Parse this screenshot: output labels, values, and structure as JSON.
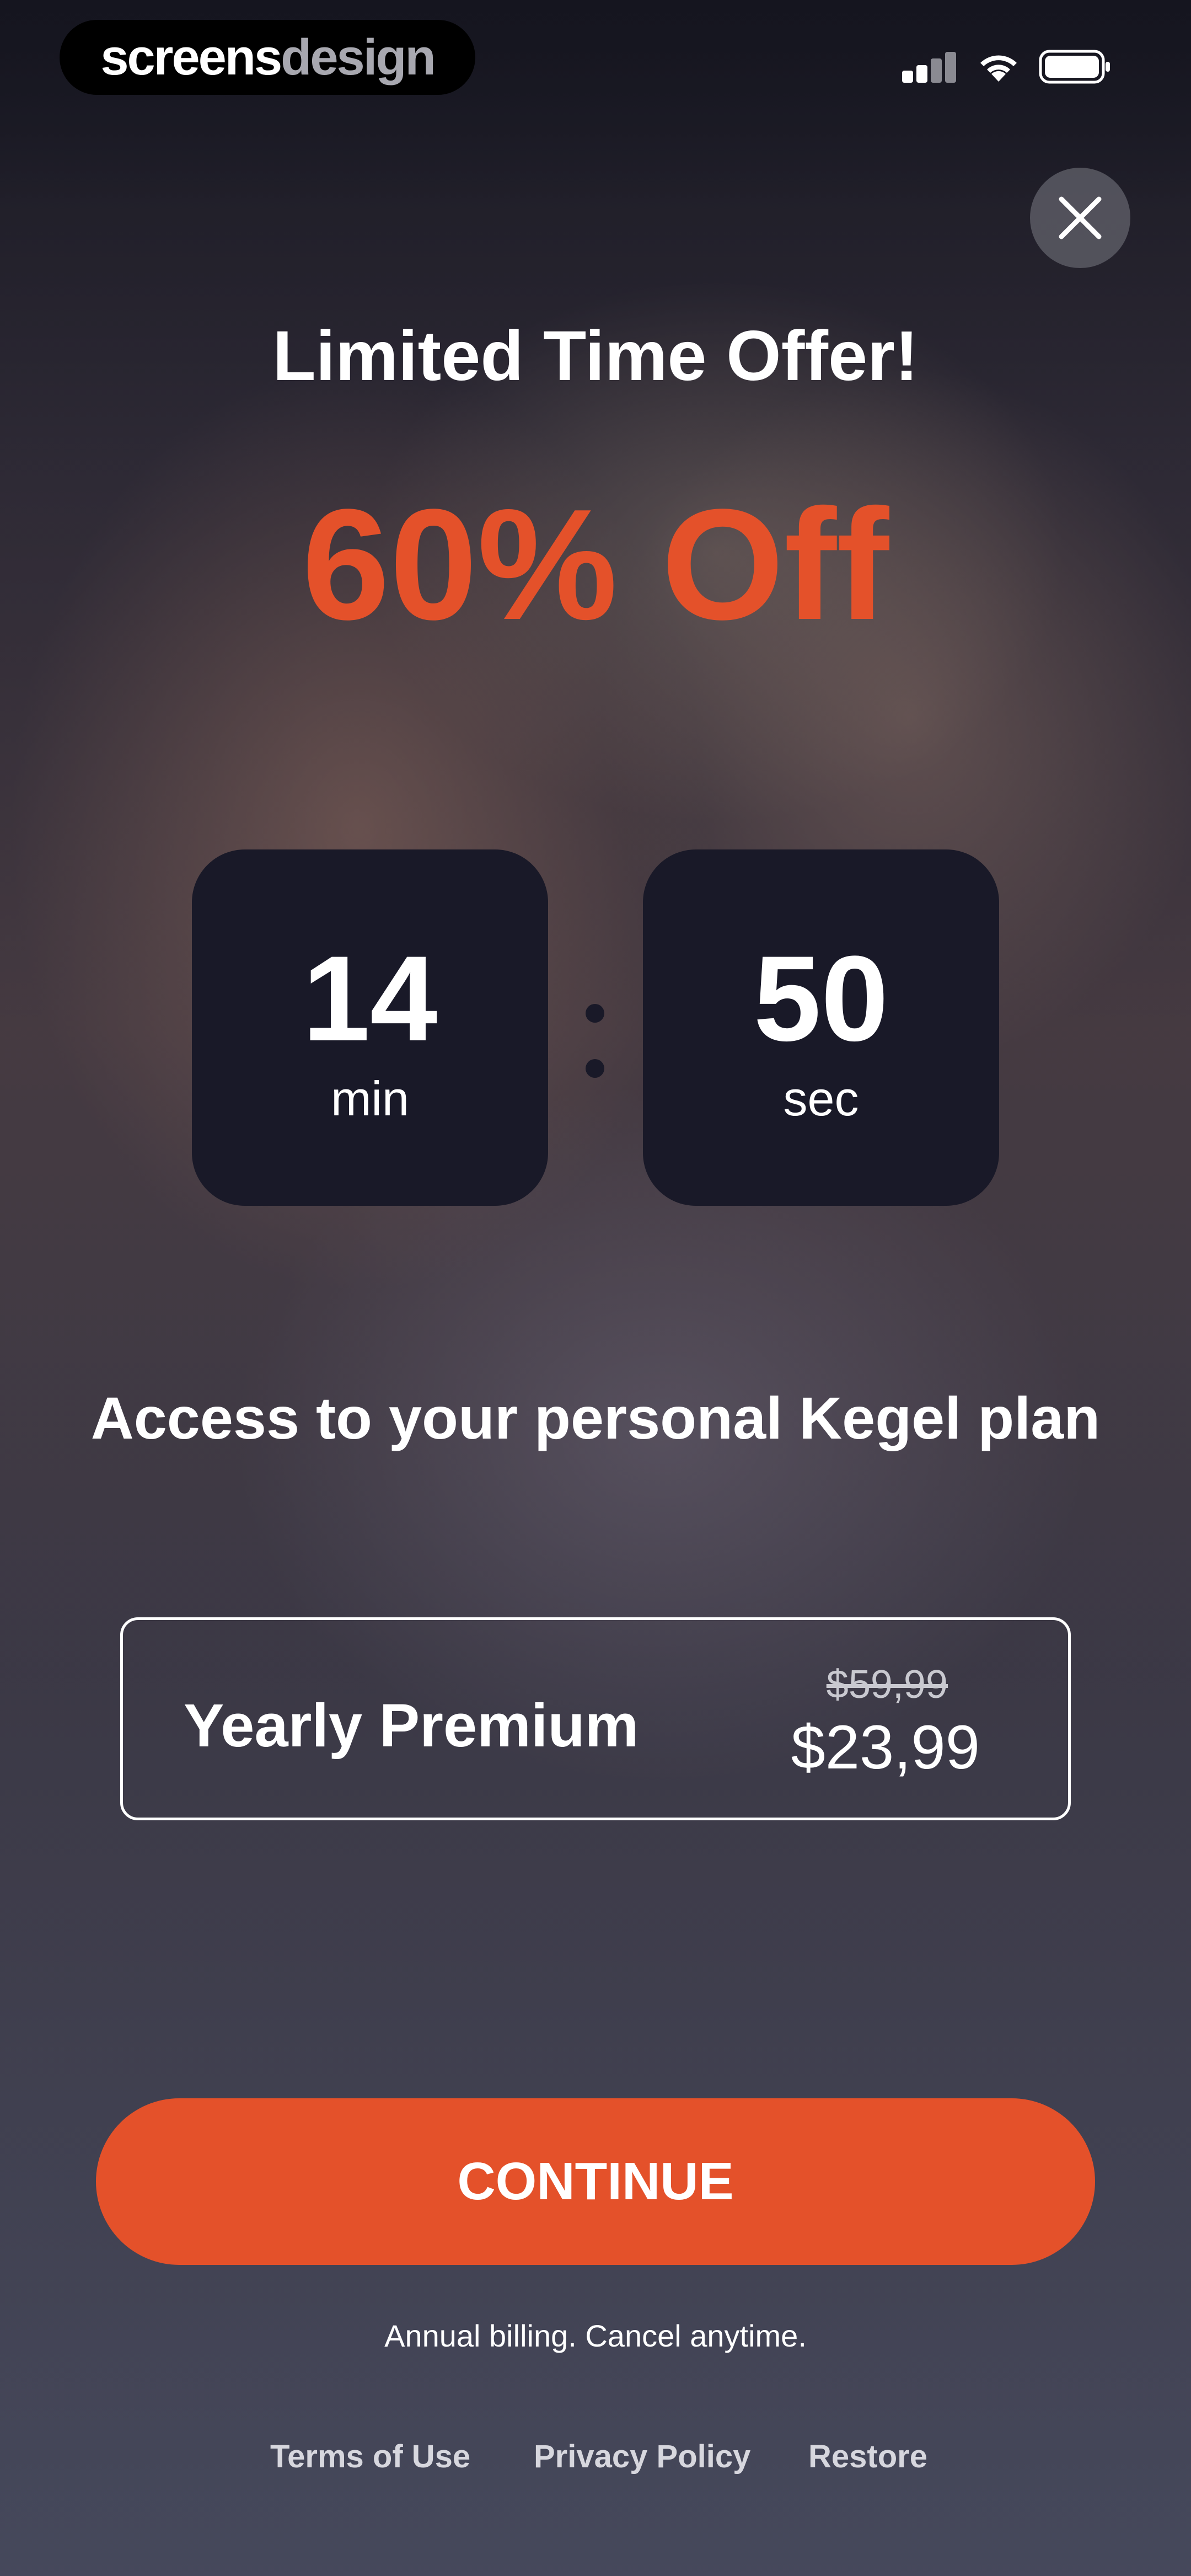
{
  "status_bar": {
    "brand_part1": "screens",
    "brand_part2": "design"
  },
  "header": {
    "title": "Limited Time Offer!",
    "discount": "60% Off"
  },
  "timer": {
    "minutes": "14",
    "minutes_label": "min",
    "seconds": "50",
    "seconds_label": "sec"
  },
  "subtitle": "Access to your personal Kegel plan",
  "plan": {
    "name": "Yearly Premium",
    "old_price": "$59,99",
    "price": "$23,99"
  },
  "cta": {
    "label": "CONTINUE",
    "note": "Annual billing. Cancel anytime."
  },
  "footer": {
    "terms": "Terms of Use",
    "privacy": "Privacy Policy",
    "restore": "Restore"
  },
  "colors": {
    "accent": "#e4512a",
    "timer_box": "#191928"
  }
}
